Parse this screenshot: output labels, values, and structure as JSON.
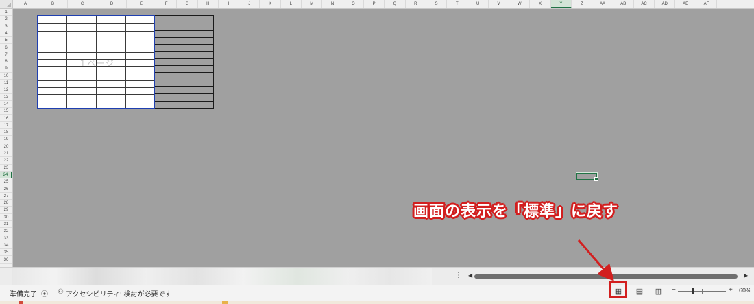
{
  "columns": [
    "A",
    "B",
    "C",
    "D",
    "E",
    "F",
    "G",
    "H",
    "I",
    "J",
    "K",
    "L",
    "M",
    "N",
    "O",
    "P",
    "Q",
    "R",
    "S",
    "T",
    "U",
    "V",
    "W",
    "X",
    "Y",
    "Z",
    "AA",
    "AB",
    "AC",
    "AD",
    "AE",
    "AF"
  ],
  "rows": [
    "1",
    "2",
    "3",
    "4",
    "5",
    "6",
    "7",
    "8",
    "9",
    "10",
    "11",
    "12",
    "13",
    "14",
    "15",
    "16",
    "17",
    "18",
    "19",
    "20",
    "21",
    "22",
    "23",
    "24",
    "25",
    "26",
    "27",
    "28",
    "29",
    "30",
    "31",
    "32",
    "33",
    "34",
    "35",
    "36"
  ],
  "active_column": "Y",
  "active_row": "24",
  "page_break": {
    "label": "１ページ"
  },
  "annotation": {
    "text": "画面の表示を「標準」に戻す",
    "color": "#d21f1f"
  },
  "status_bar": {
    "ready": "準備完了",
    "macro_icon": "macro-record-icon",
    "accessibility_icon": "accessibility-icon",
    "accessibility_text": "アクセシビリティ: 検討が必要です",
    "zoom_level": "60%"
  },
  "sheet_tabs": {
    "more_glyph": "⋮"
  },
  "view_buttons": [
    {
      "name": "normal-view",
      "icon": "grid-icon",
      "glyph": "▦",
      "selected": true
    },
    {
      "name": "page-layout-view",
      "icon": "page-layout-icon",
      "glyph": "▤",
      "selected": false
    },
    {
      "name": "page-break-preview",
      "icon": "page-break-icon",
      "glyph": "▥",
      "selected": false
    }
  ],
  "zoom": {
    "minus": "−",
    "plus": "+"
  },
  "colors": {
    "grid_background": "#a0a0a0",
    "page_border": "#1f3fb0",
    "highlight": "#d21f1f",
    "excel_green": "#217346"
  }
}
